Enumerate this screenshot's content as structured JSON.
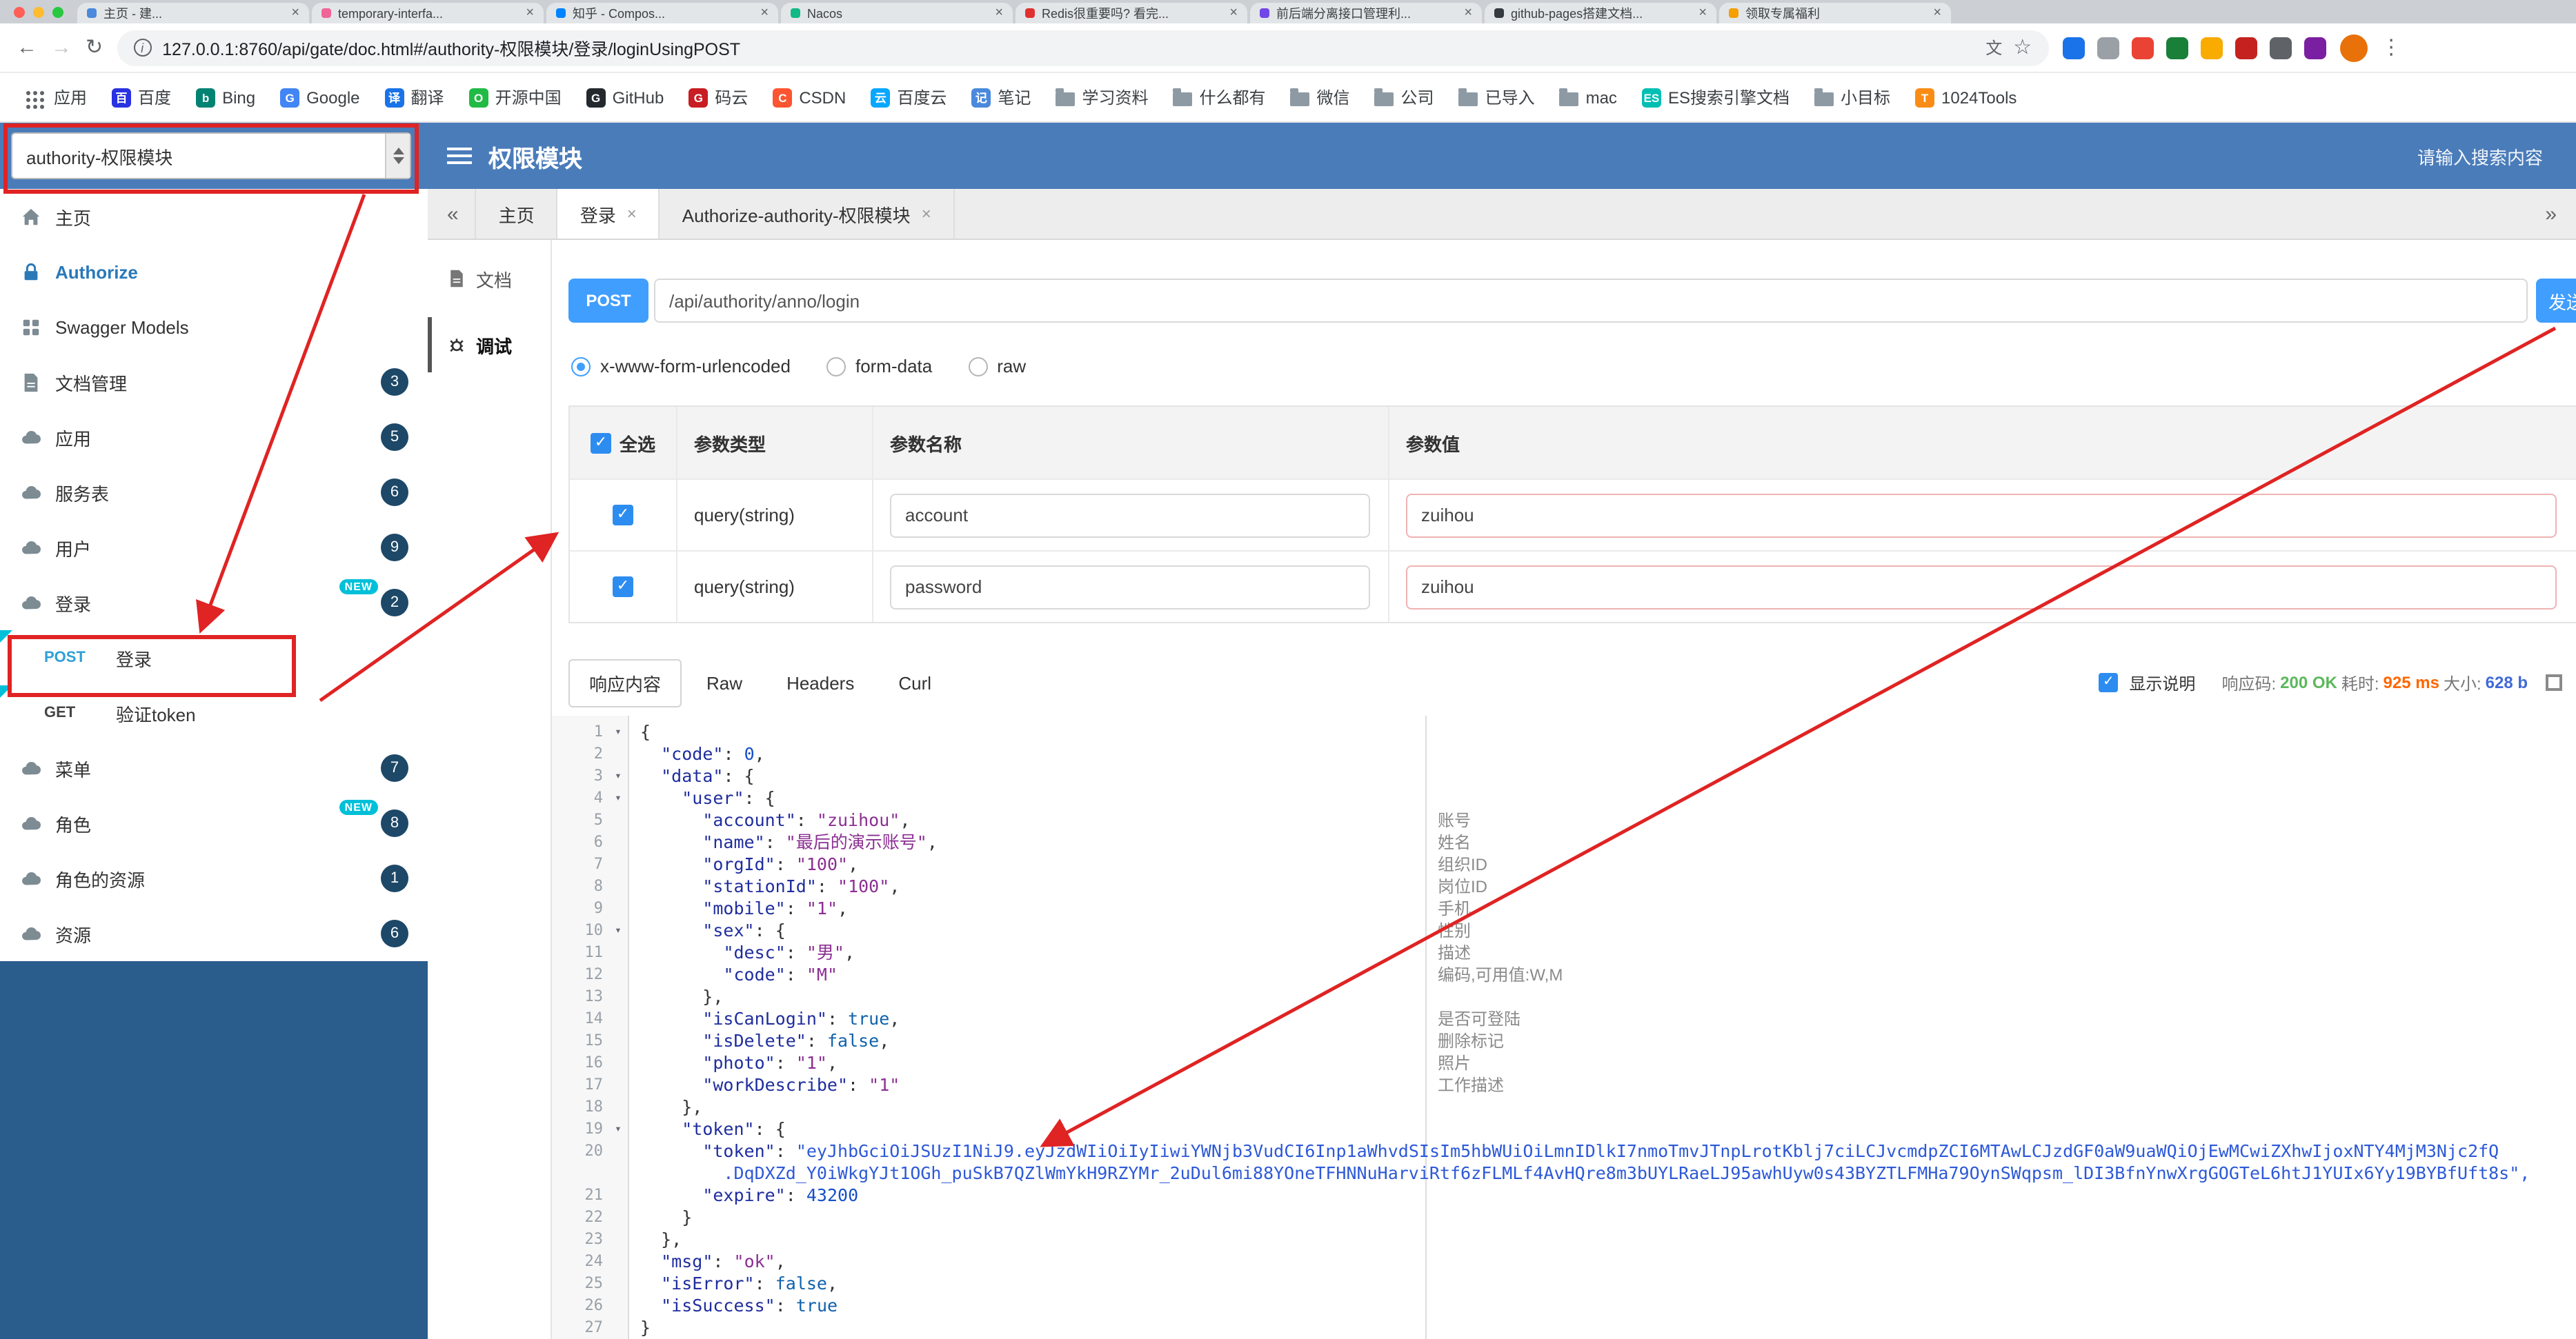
{
  "browser": {
    "tabs": [
      {
        "label": "主页 - 建...",
        "color": "#4a89dc"
      },
      {
        "label": "temporary-interfa...",
        "color": "#f06595"
      },
      {
        "label": "知乎 - Compos...",
        "color": "#0084ff"
      },
      {
        "label": "Nacos",
        "color": "#12b886"
      },
      {
        "label": "Redis很重要吗? 看完...",
        "color": "#e03131"
      },
      {
        "label": "前后端分离接口管理利...",
        "color": "#7048e8"
      },
      {
        "label": "github-pages搭建文档...",
        "color": "#343a40"
      },
      {
        "label": "领取专属福利",
        "color": "#f59f00"
      }
    ],
    "nav": {
      "url": "127.0.0.1:8760/api/gate/doc.html#/authority-权限模块/登录/loginUsingPOST",
      "ext_colors": [
        "#1a73e8",
        "#9aa0a6",
        "#ea4335",
        "#188038",
        "#f9ab00",
        "#c5221f",
        "#5f6368",
        "#7b1fa2"
      ]
    },
    "bookmarks": [
      {
        "label": "应用",
        "icon": "apps"
      },
      {
        "label": "百度",
        "icon": "baidu",
        "color": "#2932e1",
        "glyph": "百"
      },
      {
        "label": "Bing",
        "icon": "bing",
        "color": "#008373",
        "glyph": "b"
      },
      {
        "label": "Google",
        "icon": "google",
        "color": "#4285f4",
        "glyph": "G"
      },
      {
        "label": "翻译",
        "icon": "translate",
        "color": "#1a73e8",
        "glyph": "译"
      },
      {
        "label": "开源中国",
        "icon": "oschina",
        "color": "#21ba45",
        "glyph": "O"
      },
      {
        "label": "GitHub",
        "icon": "github",
        "color": "#24292e",
        "glyph": "G"
      },
      {
        "label": "码云",
        "icon": "gitee",
        "color": "#c71d23",
        "glyph": "G"
      },
      {
        "label": "CSDN",
        "icon": "csdn",
        "color": "#fc5531",
        "glyph": "C"
      },
      {
        "label": "百度云",
        "icon": "baiduyun",
        "color": "#06a7ff",
        "glyph": "云"
      },
      {
        "label": "笔记",
        "icon": "note",
        "color": "#4a89dc",
        "glyph": "记"
      },
      {
        "label": "学习资料",
        "icon": "folder"
      },
      {
        "label": "什么都有",
        "icon": "folder"
      },
      {
        "label": "微信",
        "icon": "folder"
      },
      {
        "label": "公司",
        "icon": "folder"
      },
      {
        "label": "已导入",
        "icon": "folder"
      },
      {
        "label": "mac",
        "icon": "folder"
      },
      {
        "label": "ES搜索引擎文档",
        "icon": "es",
        "color": "#00bfb3",
        "glyph": "ES"
      },
      {
        "label": "小目标",
        "icon": "folder"
      },
      {
        "label": "1024Tools",
        "icon": "tools",
        "color": "#fa8c16",
        "glyph": "T"
      }
    ]
  },
  "header": {
    "group_select": "authority-权限模块",
    "title": "权限模块",
    "search_placeholder": "请输入搜索内容"
  },
  "sidebar": {
    "new_badge": "NEW",
    "items": [
      {
        "label": "主页",
        "icon": "home"
      },
      {
        "label": "Authorize",
        "icon": "auth"
      },
      {
        "label": "Swagger Models",
        "icon": "models"
      },
      {
        "label": "文档管理",
        "icon": "doc",
        "badge": "3"
      },
      {
        "label": "应用",
        "icon": "cloud",
        "badge": "5"
      },
      {
        "label": "服务表",
        "icon": "cloud",
        "badge": "6"
      },
      {
        "label": "用户",
        "icon": "cloud",
        "badge": "9"
      },
      {
        "label": "登录",
        "icon": "cloud",
        "badge": "2",
        "new": true
      },
      {
        "label": "菜单",
        "icon": "cloud",
        "badge": "7"
      },
      {
        "label": "角色",
        "icon": "cloud",
        "badge": "8",
        "new": true
      },
      {
        "label": "角色的资源",
        "icon": "cloud",
        "badge": "1"
      },
      {
        "label": "资源",
        "icon": "cloud",
        "badge": "6"
      }
    ],
    "sub": [
      {
        "method": "POST",
        "label": "登录"
      },
      {
        "method": "GET",
        "label": "验证token"
      }
    ]
  },
  "doc_tabs": {
    "collapse": "«",
    "expand": "»",
    "items": [
      {
        "label": "主页"
      },
      {
        "label": "登录",
        "close": "×",
        "active": true
      },
      {
        "label": "Authorize-authority-权限模块",
        "close": "×"
      }
    ]
  },
  "rail": {
    "items": [
      {
        "label": "文档"
      },
      {
        "label": "调试",
        "active": true
      }
    ]
  },
  "request": {
    "method": "POST",
    "url": "/api/authority/anno/login",
    "send": "发送",
    "content_types": [
      {
        "label": "x-www-form-urlencoded",
        "selected": true
      },
      {
        "label": "form-data"
      },
      {
        "label": "raw"
      }
    ]
  },
  "params": {
    "select_all": "全选",
    "col_type": "参数类型",
    "col_name": "参数名称",
    "col_value": "参数值",
    "rows": [
      {
        "type": "query(string)",
        "name": "account",
        "value": "zuihou",
        "checked": true
      },
      {
        "type": "query(string)",
        "name": "password",
        "value": "zuihou",
        "checked": true
      }
    ]
  },
  "response": {
    "tabs": [
      {
        "label": "响应内容",
        "active": true
      },
      {
        "label": "Raw"
      },
      {
        "label": "Headers"
      },
      {
        "label": "Curl"
      }
    ],
    "show_desc": "显示说明",
    "status_label": "响应码:",
    "status": "200 OK",
    "time_label": "耗时:",
    "time": "925 ms",
    "size_label": "大小:",
    "size": "628 b"
  },
  "code": {
    "rows": [
      {
        "n": "1",
        "t": "{"
      },
      {
        "n": "2",
        "t": "  \"code\": 0,"
      },
      {
        "n": "3",
        "t": "  \"data\": {"
      },
      {
        "n": "4",
        "t": "    \"user\": {"
      },
      {
        "n": "5",
        "t": "      \"account\": \"zuihou\","
      },
      {
        "n": "6",
        "t": "      \"name\": \"最后的演示账号\","
      },
      {
        "n": "7",
        "t": "      \"orgId\": \"100\","
      },
      {
        "n": "8",
        "t": "      \"stationId\": \"100\","
      },
      {
        "n": "9",
        "t": "      \"mobile\": \"1\","
      },
      {
        "n": "10",
        "t": "      \"sex\": {"
      },
      {
        "n": "11",
        "t": "        \"desc\": \"男\","
      },
      {
        "n": "12",
        "t": "        \"code\": \"M\""
      },
      {
        "n": "13",
        "t": "      },"
      },
      {
        "n": "14",
        "t": "      \"isCanLogin\": true,"
      },
      {
        "n": "15",
        "t": "      \"isDelete\": false,"
      },
      {
        "n": "16",
        "t": "      \"photo\": \"1\","
      },
      {
        "n": "17",
        "t": "      \"workDescribe\": \"1\""
      },
      {
        "n": "18",
        "t": "    },"
      },
      {
        "n": "19",
        "t": "    \"token\": {"
      },
      {
        "n": "20",
        "t": "      \"token\": \"eyJhbGciOiJSUzI1NiJ9.eyJzdWIiOiIyIiwiYWNjb3VudCI6Inp1aWhvdSIsIm5hbWUiOiLmnIDlkI7nmoTmvJTnpLrotKblj7ciLCJvcmdpZCI6MTAwLCJzdGF0aW9uaWQiOjEwMCwiZXhwIjoxNTY4MjM3Njc2fQ"
      },
      {
        "n": "",
        "t": "        .DqDXZd_Y0iWkgYJt1OGh_puSkB7QZlWmYkH9RZYMr_2uDul6mi88YOneTFHNNuHarviRtf6zFLMLf4AvHQre8m3bUYLRaeLJ95awhUyw0s43BYZTLFMHa79OynSWqpsm_lDI3BfnYnwXrgGOGTeL6htJ1YUIx6Yy19BYBfUft8s\","
      },
      {
        "n": "21",
        "t": "      \"expire\": 43200"
      },
      {
        "n": "22",
        "t": "    }"
      },
      {
        "n": "23",
        "t": "  },"
      },
      {
        "n": "24",
        "t": "  \"msg\": \"ok\","
      },
      {
        "n": "25",
        "t": "  \"isError\": false,"
      },
      {
        "n": "26",
        "t": "  \"isSuccess\": true"
      },
      {
        "n": "27",
        "t": "}"
      }
    ]
  },
  "field_notes": [
    {
      "row": 5,
      "label": "账号"
    },
    {
      "row": 6,
      "label": "姓名"
    },
    {
      "row": 7,
      "label": "组织ID"
    },
    {
      "row": 8,
      "label": "岗位ID"
    },
    {
      "row": 9,
      "label": "手机"
    },
    {
      "row": 10,
      "label": "性别"
    },
    {
      "row": 11,
      "label": "描述"
    },
    {
      "row": 12,
      "label": "编码,可用值:W,M"
    },
    {
      "row": 14,
      "label": "是否可登陆"
    },
    {
      "row": 15,
      "label": "删除标记"
    },
    {
      "row": 16,
      "label": "照片"
    },
    {
      "row": 17,
      "label": "工作描述"
    }
  ]
}
